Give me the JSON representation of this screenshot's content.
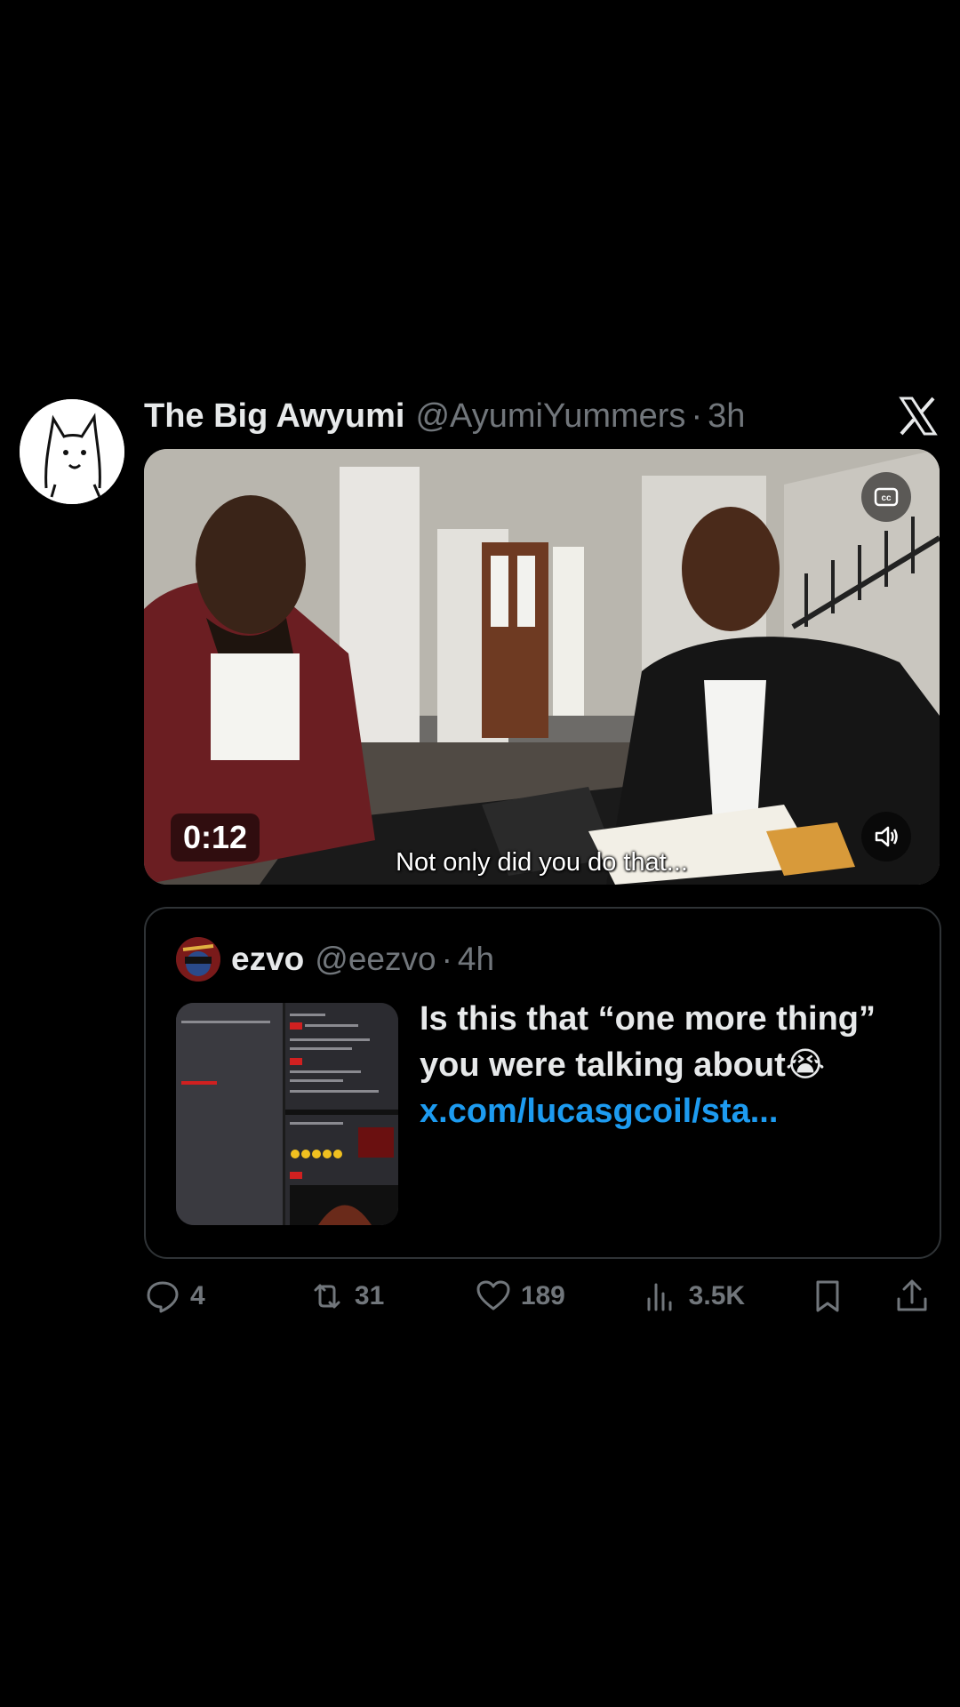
{
  "tweet": {
    "author_name": "The Big Awyumi",
    "author_handle": "@AyumiYummers",
    "separator": "·",
    "time": "3h",
    "video": {
      "duration": "0:12",
      "caption": "Not only did you do that..."
    },
    "quote": {
      "author_name": "ezvo",
      "author_handle": "@eezvo",
      "separator": "·",
      "time": "4h",
      "text": "Is this that “one more thing” you were talking about😭",
      "link": "x.com/lucasgcoil/sta..."
    },
    "actions": {
      "replies": "4",
      "reposts": "31",
      "likes": "189",
      "views": "3.5K"
    }
  },
  "icons": [
    "avatar",
    "x-logo-icon",
    "captions-icon",
    "volume-icon",
    "reply-icon",
    "repost-icon",
    "like-icon",
    "views-icon",
    "bookmark-icon",
    "share-icon"
  ],
  "colors": {
    "background": "#000000",
    "text": "#e7e9ea",
    "muted": "#71767b",
    "link": "#1d9bf0",
    "border": "#2f3336"
  }
}
